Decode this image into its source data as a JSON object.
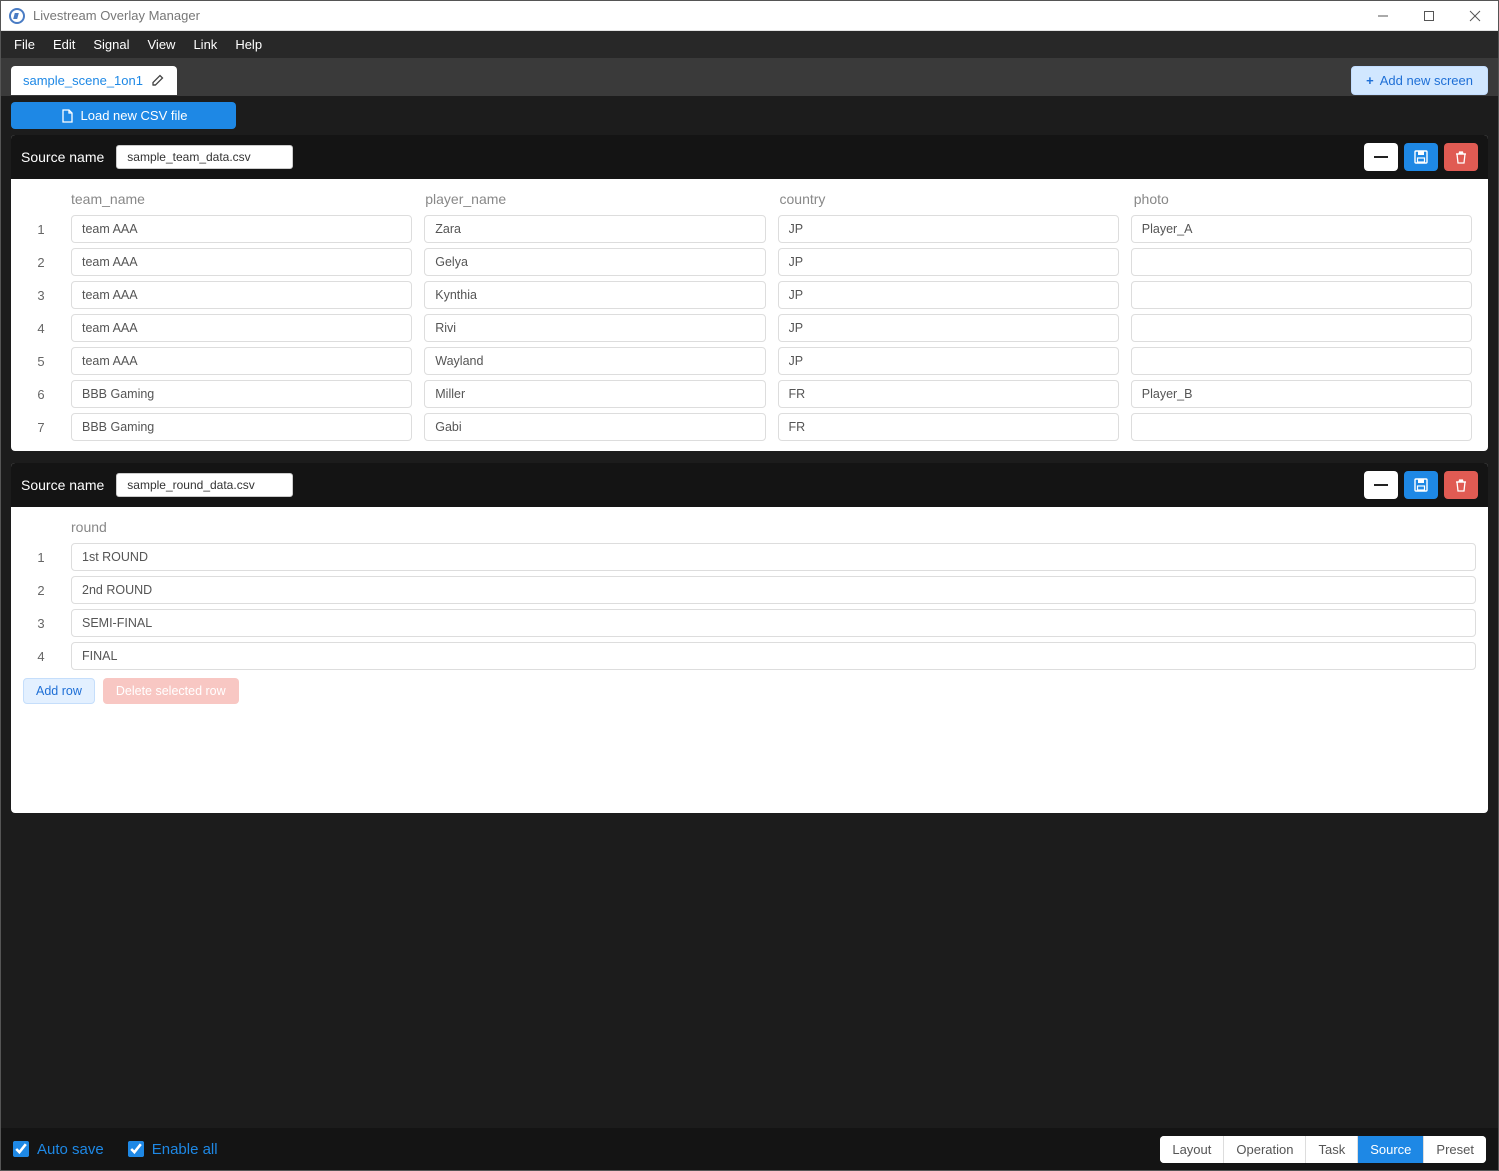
{
  "window": {
    "title": "Livestream Overlay Manager"
  },
  "menubar": {
    "items": [
      "File",
      "Edit",
      "Signal",
      "View",
      "Link",
      "Help"
    ]
  },
  "tabbar": {
    "scene_name": "sample_scene_1on1",
    "add_screen_label": "Add new screen"
  },
  "load_csv_label": "Load new CSV file",
  "panels": {
    "team": {
      "source_label": "Source name",
      "source_name": "sample_team_data.csv",
      "columns": [
        "team_name",
        "player_name",
        "country",
        "photo"
      ],
      "rows": [
        {
          "n": "1",
          "team_name": "team AAA",
          "player_name": "Zara",
          "country": "JP",
          "photo": "Player_A"
        },
        {
          "n": "2",
          "team_name": "team AAA",
          "player_name": "Gelya",
          "country": "JP",
          "photo": ""
        },
        {
          "n": "3",
          "team_name": "team AAA",
          "player_name": "Kynthia",
          "country": "JP",
          "photo": ""
        },
        {
          "n": "4",
          "team_name": "team AAA",
          "player_name": "Rivi",
          "country": "JP",
          "photo": ""
        },
        {
          "n": "5",
          "team_name": "team AAA",
          "player_name": "Wayland",
          "country": "JP",
          "photo": ""
        },
        {
          "n": "6",
          "team_name": "BBB Gaming",
          "player_name": "Miller",
          "country": "FR",
          "photo": "Player_B"
        },
        {
          "n": "7",
          "team_name": "BBB Gaming",
          "player_name": "Gabi",
          "country": "FR",
          "photo": ""
        }
      ]
    },
    "round": {
      "source_label": "Source name",
      "source_name": "sample_round_data.csv",
      "columns": [
        "round"
      ],
      "rows": [
        {
          "n": "1",
          "round": "1st ROUND"
        },
        {
          "n": "2",
          "round": "2nd ROUND"
        },
        {
          "n": "3",
          "round": "SEMI-FINAL"
        },
        {
          "n": "4",
          "round": "FINAL"
        }
      ],
      "add_row_label": "Add row",
      "delete_row_label": "Delete selected row"
    }
  },
  "footer": {
    "auto_save_label": "Auto save",
    "enable_all_label": "Enable all",
    "auto_save_checked": true,
    "enable_all_checked": true,
    "tabs": [
      "Layout",
      "Operation",
      "Task",
      "Source",
      "Preset"
    ],
    "active_tab": "Source"
  }
}
